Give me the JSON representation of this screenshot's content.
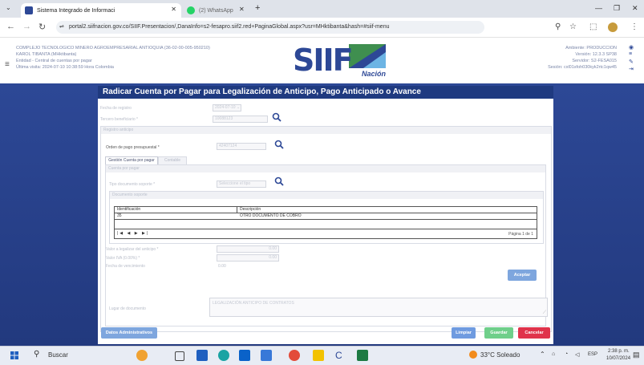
{
  "browser": {
    "tabs": [
      {
        "title": "Sistema Integrado de Informaci",
        "active": true
      },
      {
        "title": "(2) WhatsApp",
        "active": false
      }
    ],
    "new_tab": "+",
    "url": "portal2.siifnacion.gov.co/SIIF.Presentacion/,DanaInfo=s2-fesapro.siif2.red+PaginaGlobal.aspx?usr=MHktibanta&hash=#siif-menu"
  },
  "header": {
    "org": "COMPLEJO TECNOLOGICO MINERO AGROEMPRESARIAL ANTIOQUIA (36-02-00-005-950210)",
    "user": "KAROL TIBANTA (MHktibanta)",
    "entity": "Entidad - Central de cuentas por pagar",
    "last_visit": "Última visita: 2024-07-10 10:38:59 Hora Colombia",
    "logo_main": "SIIF",
    "logo_sub": "Nación",
    "ambiente": "Ambiente: PRODUCCION",
    "version": "Versión: 12.3.3 SP38",
    "servidor": "Servidor: S2-FESA015",
    "sesion": "Sesión: cxl01sfoh030kyk2rtc1qw45"
  },
  "form": {
    "title": "Radicar Cuenta por Pagar para Legalización de Anticipo, Pago Anticipado o Avance",
    "fecha_label": "Fecha de registro",
    "fecha_value": "2024-07-10",
    "tercero_label": "Tercero beneficiario *",
    "tercero_value": "10088123",
    "datos_section": "Registro anticipo",
    "orden_label": "Orden de pago presupuestal *",
    "orden_value": "42407124",
    "tabs": [
      "Gestión Cuenta por pagar",
      "Contable"
    ],
    "deducciones_section": "Cuenta por pagar",
    "tipo_doc_label": "Tipo documento soporte *",
    "tipo_doc_value": "Seleccione el tipo",
    "doc_soporte_section": "Documento soporte",
    "table_headers": [
      "Identificación",
      "Descripción"
    ],
    "table_rows": [
      [
        "35",
        "OTRO DOCUMENTO DE COBRO"
      ]
    ],
    "pager": "|◀ ◀ ▶ ▶|",
    "page_info": "Página 1 de 1",
    "valor_label": "Valor a legalizar del anticipo *",
    "valor_value": "0.00",
    "iva_label": "Valor IVA (0.00%) *",
    "iva_value": "0.00",
    "fecha_doc_label": "Fecha de vencimiento",
    "fecha_doc_value": "0.00",
    "aceptar": "Aceptar",
    "obs_label": "Lugar de documento",
    "obs_value": "LEGALIZACIÓN ANTICIPO DE CONTRATOS",
    "datos_admin": "Datos Administrativos",
    "limpiar": "Limpiar",
    "guardar": "Guardar",
    "cancelar": "Cancelar"
  },
  "taskbar": {
    "search": "Buscar",
    "weather": "33°C Soleado",
    "lang": "ESP",
    "time": "2:38 p. m.",
    "date": "10/07/2024"
  },
  "colors": {
    "title_bar": "#1f3a80",
    "page_bg": "#2d4896",
    "aceptar": "#7ea6de",
    "guardar": "#6fcf8a",
    "cancelar": "#e0334b",
    "limpiar": "#6f9be0"
  }
}
